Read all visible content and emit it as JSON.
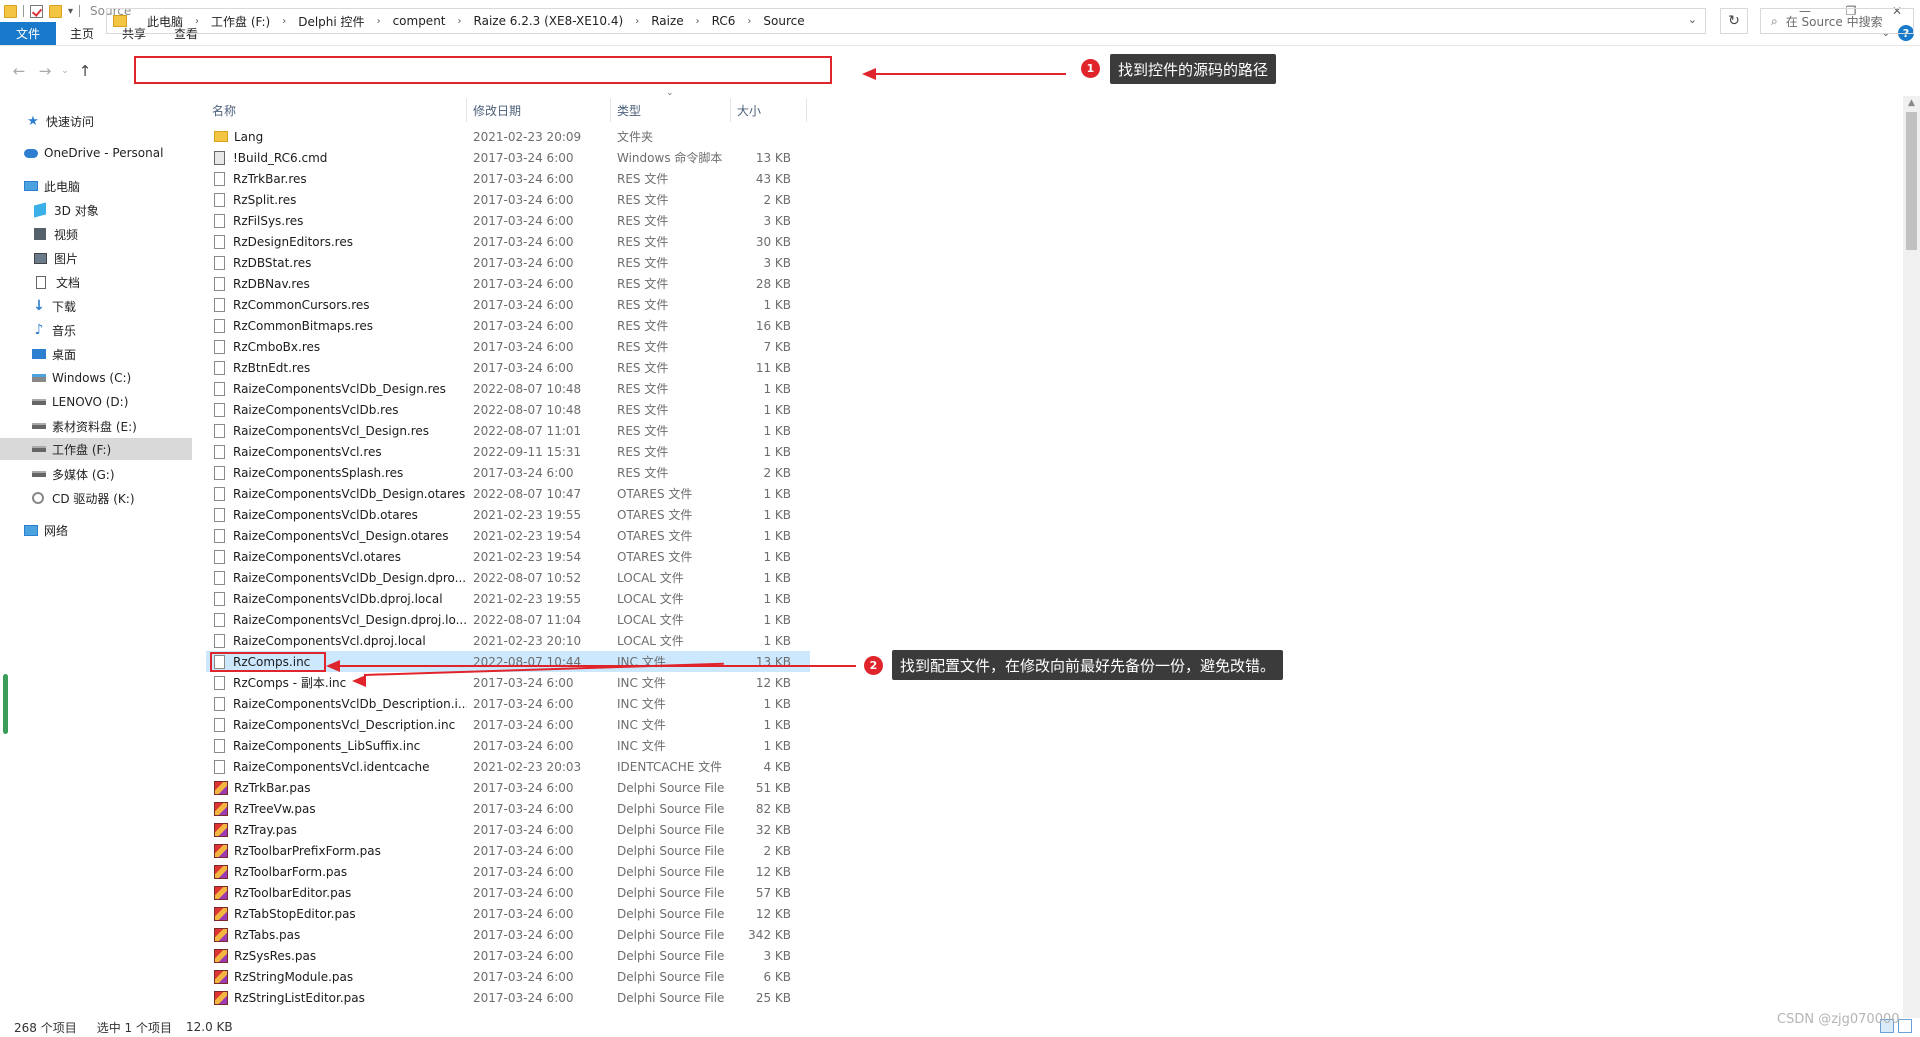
{
  "window": {
    "title": "Source",
    "controls": {
      "minimize": "—",
      "maximize": "❐",
      "close": "✕"
    }
  },
  "ribbon": {
    "tabs": [
      "文件",
      "主页",
      "共享",
      "查看"
    ],
    "help": "?"
  },
  "address": {
    "crumbs": [
      "此电脑",
      "工作盘 (F:)",
      "Delphi 控件",
      "compent",
      "Raize 6.2.3 (XE8-XE10.4)",
      "Raize",
      "RC6",
      "Source"
    ],
    "separator": "›",
    "refresh_icon": "↻",
    "search_placeholder": "在 Source 中搜索"
  },
  "annotations": {
    "a1": {
      "number": "1",
      "text": "找到控件的源码的路径"
    },
    "a2": {
      "number": "2",
      "text": "找到配置文件，在修改向前最好先备份一份，避免改错。"
    }
  },
  "nav": {
    "items": [
      {
        "label": "快速访问",
        "icon": "star-icon"
      },
      {
        "label": "OneDrive - Personal",
        "icon": "cloud-icon"
      },
      {
        "label": "此电脑",
        "icon": "computer-icon"
      },
      {
        "label": "3D 对象",
        "icon": "cube-icon"
      },
      {
        "label": "视频",
        "icon": "video-icon"
      },
      {
        "label": "图片",
        "icon": "picture-icon"
      },
      {
        "label": "文档",
        "icon": "document-icon"
      },
      {
        "label": "下载",
        "icon": "download-icon"
      },
      {
        "label": "音乐",
        "icon": "music-icon"
      },
      {
        "label": "桌面",
        "icon": "desktop-icon"
      },
      {
        "label": "Windows (C:)",
        "icon": "windows-drive-icon"
      },
      {
        "label": "LENOVO (D:)",
        "icon": "drive-icon"
      },
      {
        "label": "素材资料盘 (E:)",
        "icon": "drive-icon"
      },
      {
        "label": "工作盘 (F:)",
        "icon": "drive-icon"
      },
      {
        "label": "多媒体 (G:)",
        "icon": "drive-icon"
      },
      {
        "label": "CD 驱动器 (K:)",
        "icon": "cd-icon"
      },
      {
        "label": "网络",
        "icon": "network-icon"
      }
    ]
  },
  "columns": {
    "name": "名称",
    "date": "修改日期",
    "type": "类型",
    "size": "大小"
  },
  "files": [
    {
      "name": "Lang",
      "date": "2021-02-23 20:09",
      "type": "文件夹",
      "size": "",
      "icon": "folder"
    },
    {
      "name": "!Build_RC6.cmd",
      "date": "2017-03-24 6:00",
      "type": "Windows 命令脚本",
      "size": "13 KB",
      "icon": "cmd"
    },
    {
      "name": "RzTrkBar.res",
      "date": "2017-03-24 6:00",
      "type": "RES 文件",
      "size": "43 KB",
      "icon": "file"
    },
    {
      "name": "RzSplit.res",
      "date": "2017-03-24 6:00",
      "type": "RES 文件",
      "size": "2 KB",
      "icon": "file"
    },
    {
      "name": "RzFilSys.res",
      "date": "2017-03-24 6:00",
      "type": "RES 文件",
      "size": "3 KB",
      "icon": "file"
    },
    {
      "name": "RzDesignEditors.res",
      "date": "2017-03-24 6:00",
      "type": "RES 文件",
      "size": "30 KB",
      "icon": "file"
    },
    {
      "name": "RzDBStat.res",
      "date": "2017-03-24 6:00",
      "type": "RES 文件",
      "size": "3 KB",
      "icon": "file"
    },
    {
      "name": "RzDBNav.res",
      "date": "2017-03-24 6:00",
      "type": "RES 文件",
      "size": "28 KB",
      "icon": "file"
    },
    {
      "name": "RzCommonCursors.res",
      "date": "2017-03-24 6:00",
      "type": "RES 文件",
      "size": "1 KB",
      "icon": "file"
    },
    {
      "name": "RzCommonBitmaps.res",
      "date": "2017-03-24 6:00",
      "type": "RES 文件",
      "size": "16 KB",
      "icon": "file"
    },
    {
      "name": "RzCmboBx.res",
      "date": "2017-03-24 6:00",
      "type": "RES 文件",
      "size": "7 KB",
      "icon": "file"
    },
    {
      "name": "RzBtnEdt.res",
      "date": "2017-03-24 6:00",
      "type": "RES 文件",
      "size": "11 KB",
      "icon": "file"
    },
    {
      "name": "RaizeComponentsVclDb_Design.res",
      "date": "2022-08-07 10:48",
      "type": "RES 文件",
      "size": "1 KB",
      "icon": "file"
    },
    {
      "name": "RaizeComponentsVclDb.res",
      "date": "2022-08-07 10:48",
      "type": "RES 文件",
      "size": "1 KB",
      "icon": "file"
    },
    {
      "name": "RaizeComponentsVcl_Design.res",
      "date": "2022-08-07 11:01",
      "type": "RES 文件",
      "size": "1 KB",
      "icon": "file"
    },
    {
      "name": "RaizeComponentsVcl.res",
      "date": "2022-09-11 15:31",
      "type": "RES 文件",
      "size": "1 KB",
      "icon": "file"
    },
    {
      "name": "RaizeComponentsSplash.res",
      "date": "2017-03-24 6:00",
      "type": "RES 文件",
      "size": "2 KB",
      "icon": "file"
    },
    {
      "name": "RaizeComponentsVclDb_Design.otares",
      "date": "2022-08-07 10:47",
      "type": "OTARES 文件",
      "size": "1 KB",
      "icon": "file"
    },
    {
      "name": "RaizeComponentsVclDb.otares",
      "date": "2021-02-23 19:55",
      "type": "OTARES 文件",
      "size": "1 KB",
      "icon": "file"
    },
    {
      "name": "RaizeComponentsVcl_Design.otares",
      "date": "2021-02-23 19:54",
      "type": "OTARES 文件",
      "size": "1 KB",
      "icon": "file"
    },
    {
      "name": "RaizeComponentsVcl.otares",
      "date": "2021-02-23 19:54",
      "type": "OTARES 文件",
      "size": "1 KB",
      "icon": "file"
    },
    {
      "name": "RaizeComponentsVclDb_Design.dpro...",
      "date": "2022-08-07 10:52",
      "type": "LOCAL 文件",
      "size": "1 KB",
      "icon": "file"
    },
    {
      "name": "RaizeComponentsVclDb.dproj.local",
      "date": "2021-02-23 19:55",
      "type": "LOCAL 文件",
      "size": "1 KB",
      "icon": "file"
    },
    {
      "name": "RaizeComponentsVcl_Design.dproj.lo...",
      "date": "2022-08-07 11:04",
      "type": "LOCAL 文件",
      "size": "1 KB",
      "icon": "file"
    },
    {
      "name": "RaizeComponentsVcl.dproj.local",
      "date": "2021-02-23 20:10",
      "type": "LOCAL 文件",
      "size": "1 KB",
      "icon": "file"
    },
    {
      "name": "RzComps.inc",
      "date": "2022-08-07 10:44",
      "type": "INC 文件",
      "size": "13 KB",
      "icon": "file",
      "selected": true
    },
    {
      "name": "RzComps - 副本.inc",
      "date": "2017-03-24 6:00",
      "type": "INC 文件",
      "size": "12 KB",
      "icon": "file"
    },
    {
      "name": "RaizeComponentsVclDb_Description.i...",
      "date": "2017-03-24 6:00",
      "type": "INC 文件",
      "size": "1 KB",
      "icon": "file"
    },
    {
      "name": "RaizeComponentsVcl_Description.inc",
      "date": "2017-03-24 6:00",
      "type": "INC 文件",
      "size": "1 KB",
      "icon": "file"
    },
    {
      "name": "RaizeComponents_LibSuffix.inc",
      "date": "2017-03-24 6:00",
      "type": "INC 文件",
      "size": "1 KB",
      "icon": "file"
    },
    {
      "name": "RaizeComponentsVcl.identcache",
      "date": "2021-02-23 20:03",
      "type": "IDENTCACHE 文件",
      "size": "4 KB",
      "icon": "file"
    },
    {
      "name": "RzTrkBar.pas",
      "date": "2017-03-24 6:00",
      "type": "Delphi Source File",
      "size": "51 KB",
      "icon": "pas"
    },
    {
      "name": "RzTreeVw.pas",
      "date": "2017-03-24 6:00",
      "type": "Delphi Source File",
      "size": "82 KB",
      "icon": "pas"
    },
    {
      "name": "RzTray.pas",
      "date": "2017-03-24 6:00",
      "type": "Delphi Source File",
      "size": "32 KB",
      "icon": "pas"
    },
    {
      "name": "RzToolbarPrefixForm.pas",
      "date": "2017-03-24 6:00",
      "type": "Delphi Source File",
      "size": "2 KB",
      "icon": "pas"
    },
    {
      "name": "RzToolbarForm.pas",
      "date": "2017-03-24 6:00",
      "type": "Delphi Source File",
      "size": "12 KB",
      "icon": "pas"
    },
    {
      "name": "RzToolbarEditor.pas",
      "date": "2017-03-24 6:00",
      "type": "Delphi Source File",
      "size": "57 KB",
      "icon": "pas"
    },
    {
      "name": "RzTabStopEditor.pas",
      "date": "2017-03-24 6:00",
      "type": "Delphi Source File",
      "size": "12 KB",
      "icon": "pas"
    },
    {
      "name": "RzTabs.pas",
      "date": "2017-03-24 6:00",
      "type": "Delphi Source File",
      "size": "342 KB",
      "icon": "pas"
    },
    {
      "name": "RzSysRes.pas",
      "date": "2017-03-24 6:00",
      "type": "Delphi Source File",
      "size": "3 KB",
      "icon": "pas"
    },
    {
      "name": "RzStringModule.pas",
      "date": "2017-03-24 6:00",
      "type": "Delphi Source File",
      "size": "6 KB",
      "icon": "pas"
    },
    {
      "name": "RzStringListEditor.pas",
      "date": "2017-03-24 6:00",
      "type": "Delphi Source File",
      "size": "25 KB",
      "icon": "pas"
    }
  ],
  "status": {
    "count": "268 个项目",
    "selection": "选中 1 个项目",
    "size": "12.0 KB"
  },
  "watermark": "CSDN @zjg070000"
}
